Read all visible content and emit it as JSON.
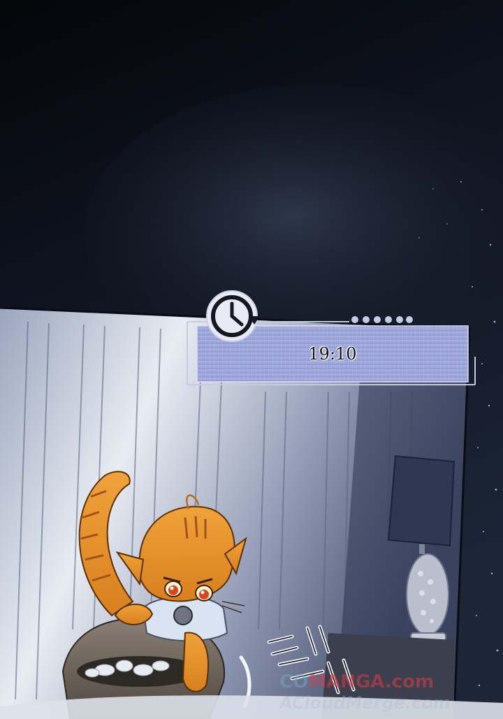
{
  "panel": {
    "time": "19:10",
    "clock_icon": "clock-rewind-icon"
  },
  "watermark": {
    "line1_prefix": "CO",
    "line1_brand": "MANGA",
    "line1_suffix": ".com",
    "line2": "ACloudMerge.com"
  },
  "colors": {
    "night_sky": "#0b0d14",
    "wall": "#b8c0d4",
    "cat_orange": "#e8952a",
    "time_box": "#9aa4d8"
  }
}
